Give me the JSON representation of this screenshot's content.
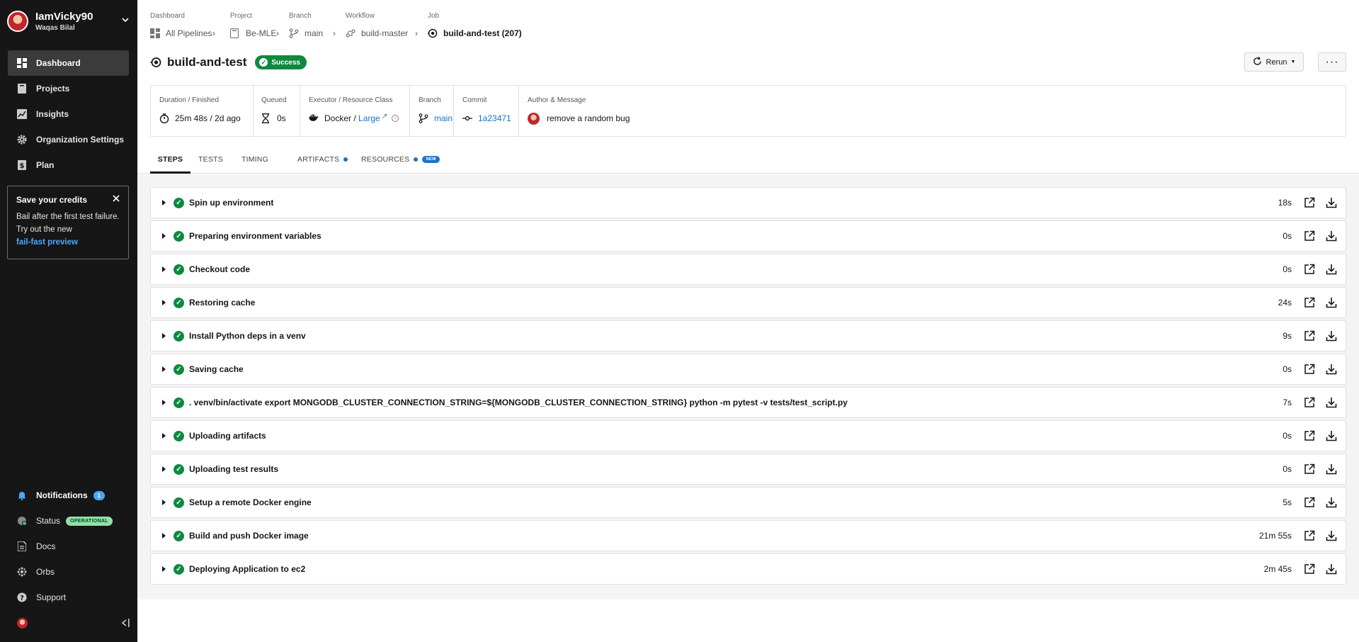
{
  "user": {
    "handle": "IamVicky90",
    "name": "Waqas Bilal"
  },
  "nav": [
    {
      "label": "Dashboard",
      "icon": "dashboard-icon"
    },
    {
      "label": "Projects",
      "icon": "projects-icon"
    },
    {
      "label": "Insights",
      "icon": "insights-icon"
    },
    {
      "label": "Organization Settings",
      "icon": "gear-icon"
    },
    {
      "label": "Plan",
      "icon": "plan-icon"
    }
  ],
  "credits": {
    "title": "Save your credits",
    "body": "Bail after the first test failure. Try out the new",
    "link": "fail-fast preview"
  },
  "bottom_nav": {
    "notifications": {
      "label": "Notifications",
      "count": "1"
    },
    "status": {
      "label": "Status",
      "badge": "OPERATIONAL"
    },
    "docs": "Docs",
    "orbs": "Orbs",
    "support": "Support"
  },
  "breadcrumb_labels": {
    "dashboard": "Dashboard",
    "project": "Project",
    "branch": "Branch",
    "workflow": "Workflow",
    "job": "Job"
  },
  "breadcrumbs": {
    "pipelines": "All Pipelines",
    "project": "Be-MLE",
    "branch": "main",
    "workflow": "build-master",
    "job": "build-and-test (207)"
  },
  "job": {
    "title": "build-and-test",
    "status": "Success"
  },
  "actions": {
    "rerun": "Rerun",
    "more": "···"
  },
  "summary": {
    "duration": {
      "label": "Duration / Finished",
      "value": "25m 48s / 2d ago"
    },
    "queued": {
      "label": "Queued",
      "value": "0s"
    },
    "executor": {
      "label": "Executor / Resource Class",
      "executor": "Docker",
      "separator": " / ",
      "resource": "Large",
      "info": "i"
    },
    "branch": {
      "label": "Branch",
      "value": "main"
    },
    "commit": {
      "label": "Commit",
      "value": "1a23471"
    },
    "author": {
      "label": "Author & Message",
      "value": "remove a random bug"
    }
  },
  "tabs": {
    "steps": "STEPS",
    "tests": "TESTS",
    "timing": "TIMING",
    "artifacts": "ARTIFACTS",
    "resources": "RESOURCES",
    "new_badge": "NEW"
  },
  "steps": [
    {
      "name": "Spin up environment",
      "duration": "18s"
    },
    {
      "name": "Preparing environment variables",
      "duration": "0s"
    },
    {
      "name": "Checkout code",
      "duration": "0s"
    },
    {
      "name": "Restoring cache",
      "duration": "24s"
    },
    {
      "name": "Install Python deps in a venv",
      "duration": "9s"
    },
    {
      "name": "Saving cache",
      "duration": "0s"
    },
    {
      "name": ". venv/bin/activate export MONGODB_CLUSTER_CONNECTION_STRING=${MONGODB_CLUSTER_CONNECTION_STRING} python -m pytest -v tests/test_script.py",
      "duration": "7s"
    },
    {
      "name": "Uploading artifacts",
      "duration": "0s"
    },
    {
      "name": "Uploading test results",
      "duration": "0s"
    },
    {
      "name": "Setup a remote Docker engine",
      "duration": "5s"
    },
    {
      "name": "Build and push Docker image",
      "duration": "21m 55s"
    },
    {
      "name": "Deploying Application to ec2",
      "duration": "2m 45s"
    }
  ],
  "colors": {
    "sidebar": "#161616",
    "success": "#0d8a3e",
    "link": "#1a73c8",
    "badge_blue": "#4aa7f3",
    "operational": "#8fe1a4"
  }
}
